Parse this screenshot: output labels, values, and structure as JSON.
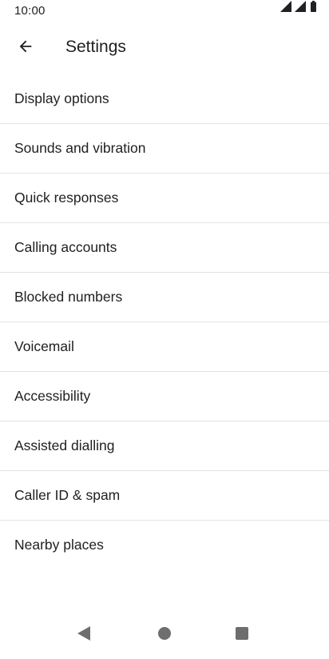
{
  "status_bar": {
    "time": "10:00",
    "icons": [
      "signal-icon",
      "signal-icon",
      "battery-icon"
    ]
  },
  "app_bar": {
    "back_icon": "arrow-back-icon",
    "title": "Settings"
  },
  "settings": {
    "items": [
      {
        "label": "Display options"
      },
      {
        "label": "Sounds and vibration"
      },
      {
        "label": "Quick responses"
      },
      {
        "label": "Calling accounts"
      },
      {
        "label": "Blocked numbers"
      },
      {
        "label": "Voicemail"
      },
      {
        "label": "Accessibility"
      },
      {
        "label": "Assisted dialling"
      },
      {
        "label": "Caller ID & spam"
      },
      {
        "label": "Nearby places"
      }
    ]
  },
  "nav_bar": {
    "icons": [
      "nav-back-icon",
      "nav-home-icon",
      "nav-recents-icon"
    ]
  },
  "colors": {
    "text": "#202124",
    "divider": "#e3e3e3",
    "nav_icon": "#6e6e6e"
  }
}
